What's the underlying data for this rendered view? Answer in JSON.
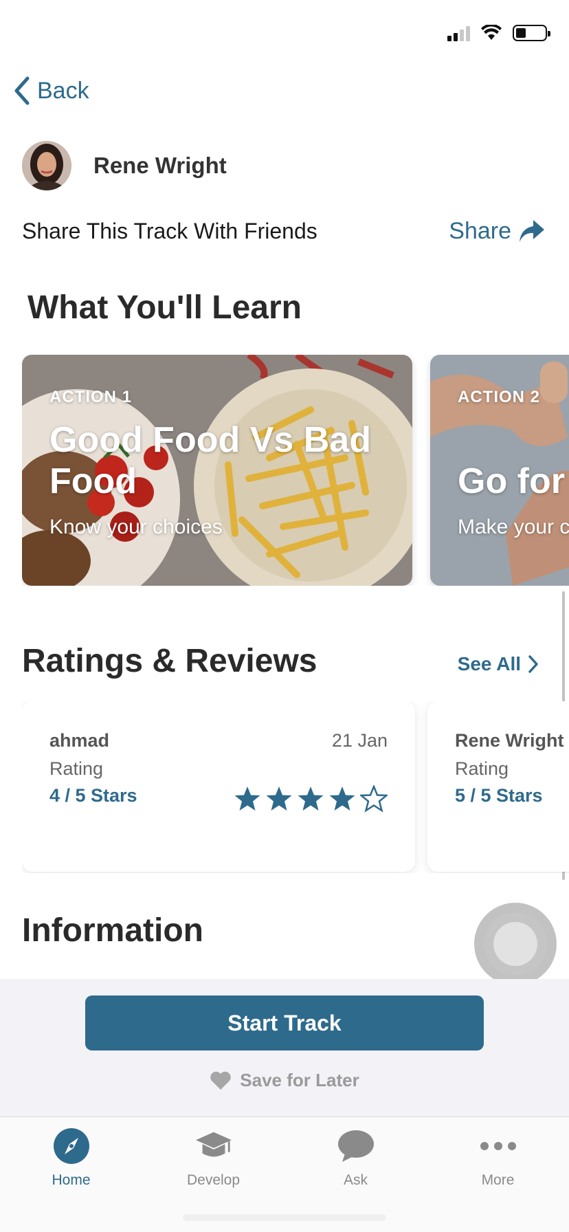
{
  "nav": {
    "back_label": "Back"
  },
  "author": {
    "name": "Rene Wright"
  },
  "share": {
    "text": "Share This Track With Friends",
    "link_label": "Share"
  },
  "learn": {
    "title": "What You'll Learn",
    "actions": [
      {
        "label": "ACTION 1",
        "title": "Good Food Vs Bad Food",
        "subtitle": "Know your choices"
      },
      {
        "label": "ACTION 2",
        "title": "Go for",
        "subtitle": "Make your c"
      }
    ]
  },
  "ratings": {
    "title": "Ratings & Reviews",
    "see_all_label": "See All",
    "reviews": [
      {
        "user": "ahmad",
        "date": "21 Jan",
        "rating_label": "Rating",
        "rating_value": "4 / 5 Stars",
        "stars": 4
      },
      {
        "user": "Rene Wright",
        "date": "",
        "rating_label": "Rating",
        "rating_value": "5 / 5 Stars",
        "stars": 5
      }
    ]
  },
  "information": {
    "title": "Information"
  },
  "actions": {
    "start_label": "Start Track",
    "save_label": "Save for Later"
  },
  "tabs": [
    {
      "label": "Home",
      "icon": "compass-icon",
      "active": true
    },
    {
      "label": "Develop",
      "icon": "graduation-cap-icon",
      "active": false
    },
    {
      "label": "Ask",
      "icon": "chat-bubble-icon",
      "active": false
    },
    {
      "label": "More",
      "icon": "more-dots-icon",
      "active": false
    }
  ],
  "colors": {
    "accent": "#2e6a8c",
    "panel": "#f2f2f7",
    "muted": "#8a8a8a"
  }
}
